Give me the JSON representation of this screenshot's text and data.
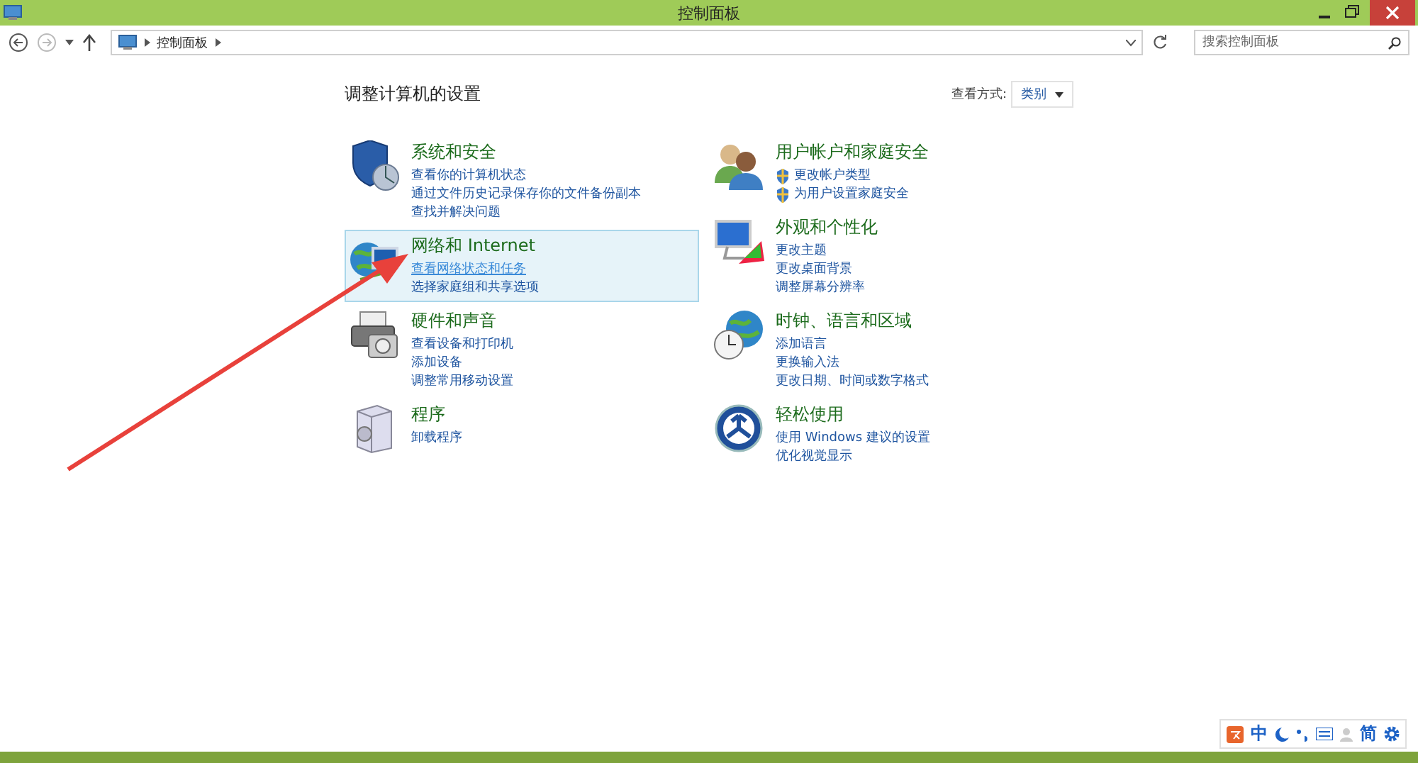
{
  "window": {
    "title": "控制面板"
  },
  "address_bar": {
    "path": [
      "控制面板"
    ]
  },
  "search": {
    "placeholder": "搜索控制面板"
  },
  "heading": "调整计算机的设置",
  "view_by": {
    "label": "查看方式:",
    "value": "类别"
  },
  "columns": [
    [
      {
        "title": "系统和安全",
        "highlighted": false,
        "links": [
          {
            "text": "查看你的计算机状态",
            "shield": false,
            "hovered": false
          },
          {
            "text": "通过文件历史记录保存你的文件备份副本",
            "shield": false,
            "hovered": false
          },
          {
            "text": "查找并解决问题",
            "shield": false,
            "hovered": false
          }
        ]
      },
      {
        "title": "网络和 Internet",
        "highlighted": true,
        "links": [
          {
            "text": "查看网络状态和任务",
            "shield": false,
            "hovered": true
          },
          {
            "text": "选择家庭组和共享选项",
            "shield": false,
            "hovered": false
          }
        ]
      },
      {
        "title": "硬件和声音",
        "highlighted": false,
        "links": [
          {
            "text": "查看设备和打印机",
            "shield": false,
            "hovered": false
          },
          {
            "text": "添加设备",
            "shield": false,
            "hovered": false
          },
          {
            "text": "调整常用移动设置",
            "shield": false,
            "hovered": false
          }
        ]
      },
      {
        "title": "程序",
        "highlighted": false,
        "links": [
          {
            "text": "卸载程序",
            "shield": false,
            "hovered": false
          }
        ]
      }
    ],
    [
      {
        "title": "用户帐户和家庭安全",
        "highlighted": false,
        "links": [
          {
            "text": "更改帐户类型",
            "shield": true,
            "hovered": false
          },
          {
            "text": "为用户设置家庭安全",
            "shield": true,
            "hovered": false
          }
        ]
      },
      {
        "title": "外观和个性化",
        "highlighted": false,
        "links": [
          {
            "text": "更改主题",
            "shield": false,
            "hovered": false
          },
          {
            "text": "更改桌面背景",
            "shield": false,
            "hovered": false
          },
          {
            "text": "调整屏幕分辨率",
            "shield": false,
            "hovered": false
          }
        ]
      },
      {
        "title": "时钟、语言和区域",
        "highlighted": false,
        "links": [
          {
            "text": "添加语言",
            "shield": false,
            "hovered": false
          },
          {
            "text": "更换输入法",
            "shield": false,
            "hovered": false
          },
          {
            "text": "更改日期、时间或数字格式",
            "shield": false,
            "hovered": false
          }
        ]
      },
      {
        "title": "轻松使用",
        "highlighted": false,
        "links": [
          {
            "text": "使用 Windows 建议的设置",
            "shield": false,
            "hovered": false
          },
          {
            "text": "优化视觉显示",
            "shield": false,
            "hovered": false
          }
        ]
      }
    ]
  ],
  "ime_bar": {
    "mode": "中",
    "charset": "简"
  }
}
